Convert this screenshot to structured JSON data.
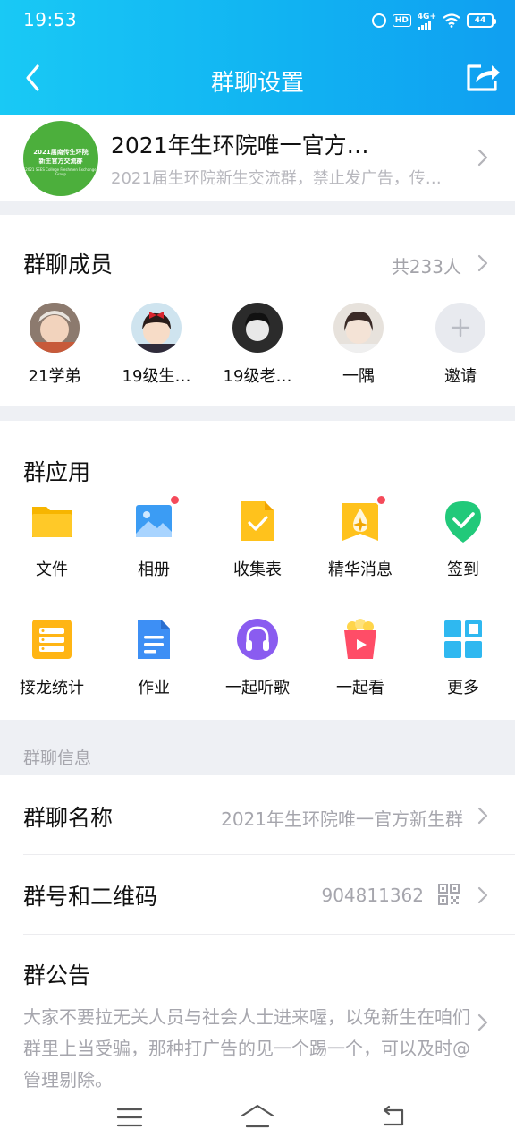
{
  "status_bar": {
    "time": "19:53",
    "hd": "HD",
    "network": "4G+",
    "battery": "44"
  },
  "nav": {
    "title": "群聊设置"
  },
  "group": {
    "name": "2021年生环院唯一官方…",
    "description": "2021届生环院新生交流群，禁止发广告，传…",
    "avatar_text": [
      "2021届南传生环院",
      "新生官方交流群",
      "2021 SEES College Freshmen Exchange Group"
    ]
  },
  "members": {
    "title": "群聊成员",
    "count": "共233人",
    "list": [
      {
        "name": "21学弟"
      },
      {
        "name": "19级生…"
      },
      {
        "name": "19级老…"
      },
      {
        "name": "一隅"
      },
      {
        "name": "邀请"
      }
    ]
  },
  "apps": {
    "title": "群应用",
    "items": [
      {
        "label": "文件",
        "icon": "folder-icon"
      },
      {
        "label": "相册",
        "icon": "album-icon"
      },
      {
        "label": "收集表",
        "icon": "form-icon"
      },
      {
        "label": "精华消息",
        "icon": "essence-icon"
      },
      {
        "label": "签到",
        "icon": "checkin-icon"
      },
      {
        "label": "接龙统计",
        "icon": "relay-icon"
      },
      {
        "label": "作业",
        "icon": "homework-icon"
      },
      {
        "label": "一起听歌",
        "icon": "music-icon"
      },
      {
        "label": "一起看",
        "icon": "watch-icon"
      },
      {
        "label": "更多",
        "icon": "more-icon"
      }
    ]
  },
  "info": {
    "section_label": "群聊信息",
    "name_row": {
      "title": "群聊名称",
      "value": "2021年生环院唯一官方新生群"
    },
    "number_row": {
      "title": "群号和二维码",
      "value": "904811362"
    },
    "notice_row": {
      "title": "群公告",
      "text": "大家不要拉无关人员与社会人士进来喔，以免新生在咱们群里上当受骗，那种打广告的见一个踢一个，可以及时@管理剔除。"
    }
  },
  "colors": {
    "header_start": "#19c9f5",
    "header_end": "#109ff1",
    "badge": "#f54a5a",
    "group_avatar": "#4caf3c"
  }
}
